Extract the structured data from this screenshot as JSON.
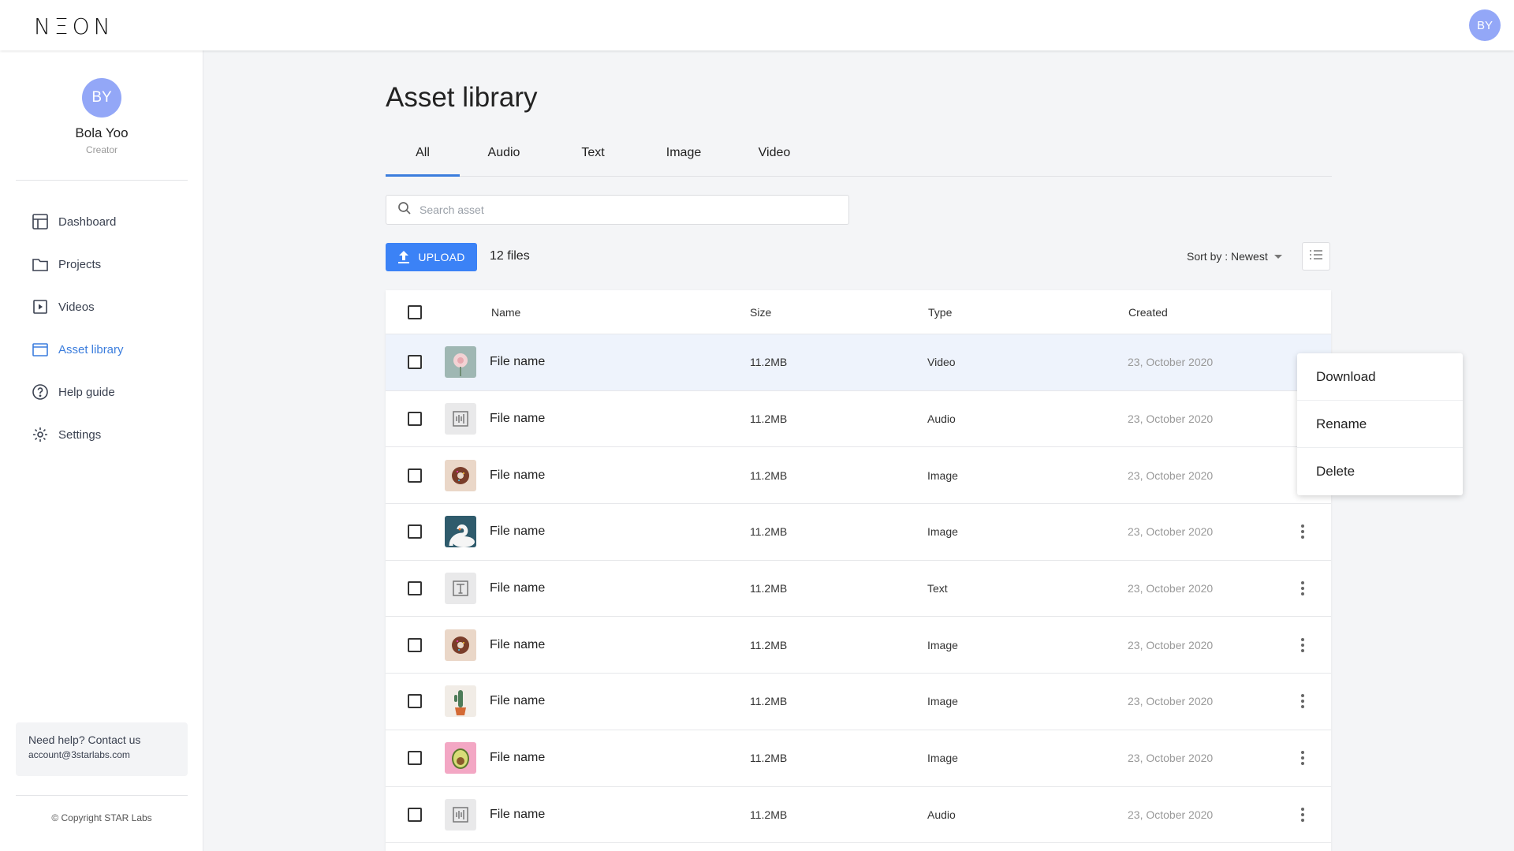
{
  "app": {
    "logo": "NΞON",
    "user_initials": "BY"
  },
  "sidebar": {
    "profile": {
      "initials": "BY",
      "name": "Bola Yoo",
      "role": "Creator"
    },
    "items": [
      {
        "label": "Dashboard",
        "icon": "dashboard-icon",
        "active": false
      },
      {
        "label": "Projects",
        "icon": "folder-icon",
        "active": false
      },
      {
        "label": "Videos",
        "icon": "video-icon",
        "active": false
      },
      {
        "label": "Asset library",
        "icon": "asset-library-icon",
        "active": true
      },
      {
        "label": "Help guide",
        "icon": "help-icon",
        "active": false
      },
      {
        "label": "Settings",
        "icon": "gear-icon",
        "active": false
      }
    ],
    "help": {
      "title": "Need help? Contact us",
      "email": "account@3starlabs.com"
    },
    "copyright": "© Copyright STAR Labs"
  },
  "main": {
    "title": "Asset library",
    "tabs": [
      {
        "label": "All",
        "active": true
      },
      {
        "label": "Audio",
        "active": false
      },
      {
        "label": "Text",
        "active": false
      },
      {
        "label": "Image",
        "active": false
      },
      {
        "label": "Video",
        "active": false
      }
    ],
    "search": {
      "placeholder": "Search asset",
      "value": ""
    },
    "upload_label": "UPLOAD",
    "file_count": "12 files",
    "sort_label": "Sort by : Newest"
  },
  "table": {
    "columns": {
      "name": "Name",
      "size": "Size",
      "type": "Type",
      "created": "Created"
    },
    "rows": [
      {
        "name": "File name",
        "size": "11.2MB",
        "type": "Video",
        "created": "23, October 2020",
        "thumb": "flower"
      },
      {
        "name": "File name",
        "size": "11.2MB",
        "type": "Audio",
        "created": "23, October 2020",
        "thumb": "audio"
      },
      {
        "name": "File name",
        "size": "11.2MB",
        "type": "Image",
        "created": "23, October 2020",
        "thumb": "donut"
      },
      {
        "name": "File name",
        "size": "11.2MB",
        "type": "Image",
        "created": "23, October 2020",
        "thumb": "swan"
      },
      {
        "name": "File name",
        "size": "11.2MB",
        "type": "Text",
        "created": "23, October 2020",
        "thumb": "text"
      },
      {
        "name": "File name",
        "size": "11.2MB",
        "type": "Image",
        "created": "23, October 2020",
        "thumb": "donut"
      },
      {
        "name": "File name",
        "size": "11.2MB",
        "type": "Image",
        "created": "23, October 2020",
        "thumb": "cactus"
      },
      {
        "name": "File name",
        "size": "11.2MB",
        "type": "Image",
        "created": "23, October 2020",
        "thumb": "avocado"
      },
      {
        "name": "File name",
        "size": "11.2MB",
        "type": "Audio",
        "created": "23, October 2020",
        "thumb": "audio"
      }
    ]
  },
  "context_menu": {
    "items": [
      "Download",
      "Rename",
      "Delete"
    ]
  },
  "colors": {
    "accent": "#3b82f6",
    "active_nav": "#3b7ddd",
    "avatar": "#93a7f7",
    "row_highlight": "#eef3fc"
  }
}
